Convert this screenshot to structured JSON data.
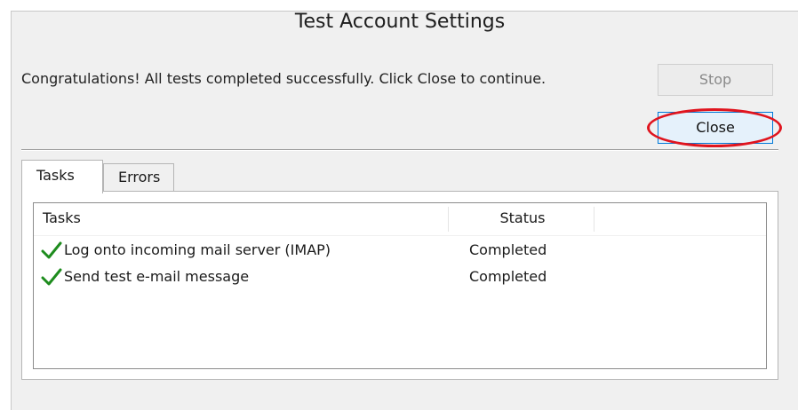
{
  "window": {
    "title": "Test Account Settings"
  },
  "message": "Congratulations! All tests completed successfully. Click Close to continue.",
  "buttons": {
    "stop": "Stop",
    "close": "Close"
  },
  "tabs": [
    {
      "label": "Tasks"
    },
    {
      "label": "Errors"
    }
  ],
  "table": {
    "columns": {
      "task": "Tasks",
      "status": "Status"
    },
    "rows": [
      {
        "icon": "checkmark-icon",
        "task": "Log onto incoming mail server (IMAP)",
        "status": "Completed"
      },
      {
        "icon": "checkmark-icon",
        "task": "Send test e-mail message",
        "status": "Completed"
      }
    ]
  },
  "colors": {
    "check": "#1e8c1e",
    "highlight": "#e0141e",
    "focus": "#0078d7"
  }
}
